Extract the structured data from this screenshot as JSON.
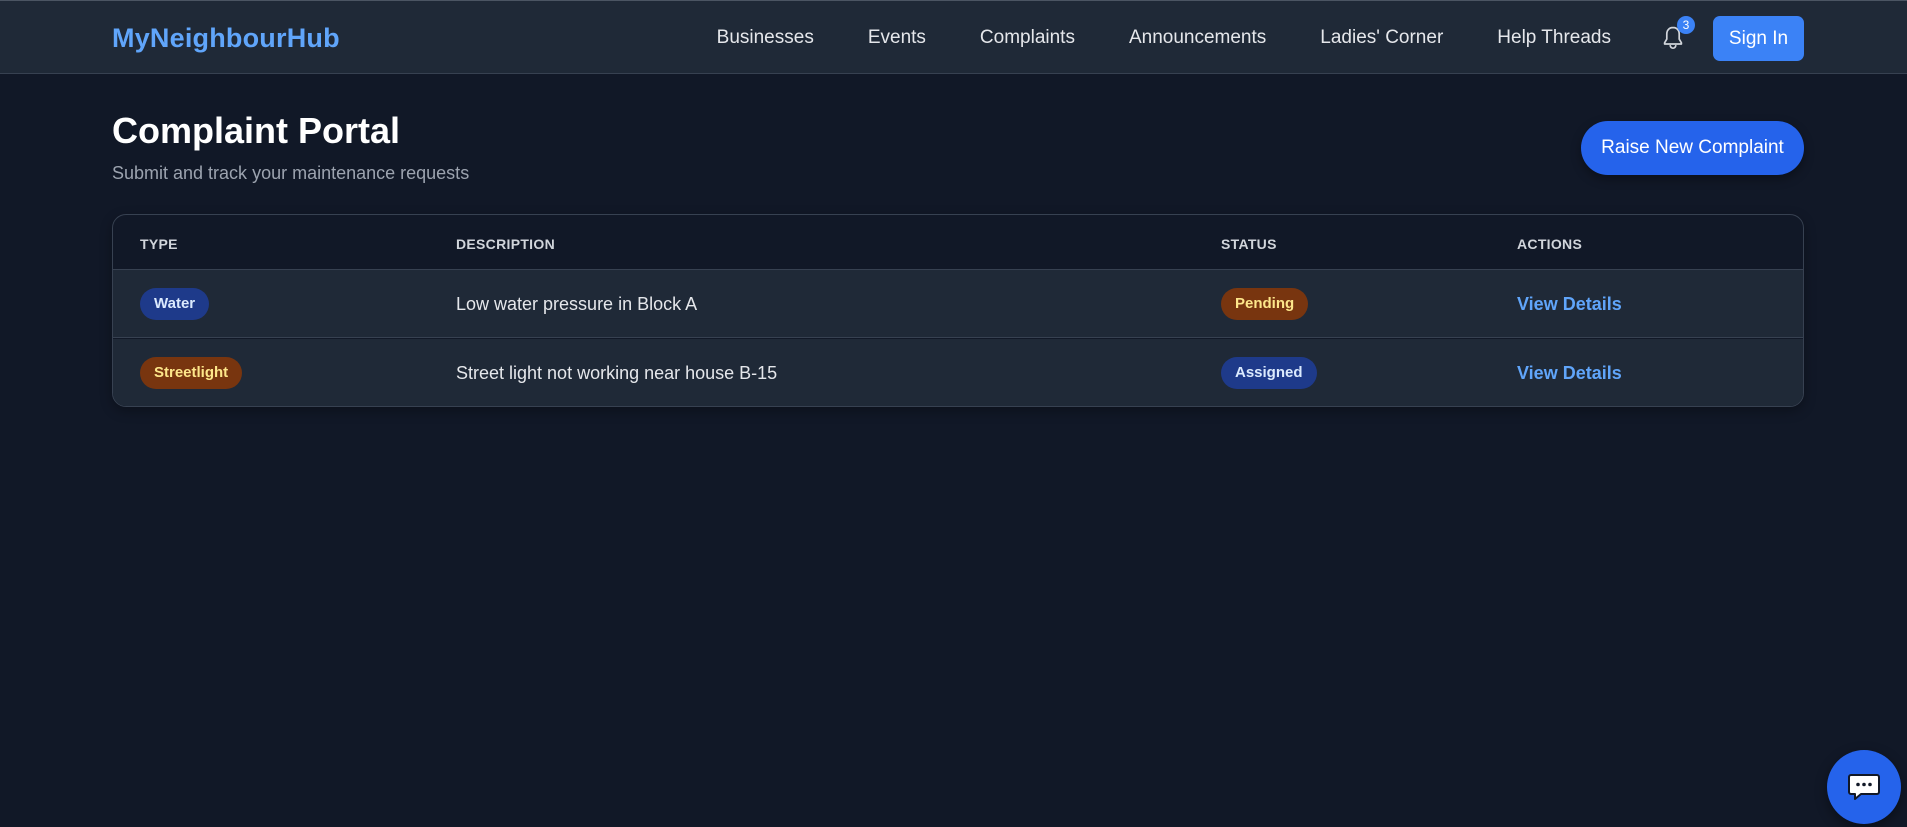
{
  "header": {
    "brand": "MyNeighbourHub",
    "nav": [
      "Businesses",
      "Events",
      "Complaints",
      "Announcements",
      "Ladies' Corner",
      "Help Threads"
    ],
    "notification_count": "3",
    "notification_icon": "bell-icon",
    "signin_label": "Sign In"
  },
  "page": {
    "title": "Complaint Portal",
    "subtitle": "Submit and track your maintenance requests",
    "raise_label": "Raise New Complaint"
  },
  "table": {
    "columns": [
      "TYPE",
      "DESCRIPTION",
      "STATUS",
      "ACTIONS"
    ],
    "rows": [
      {
        "type": "Water",
        "description": "Low water pressure in Block A",
        "status": "Pending",
        "action": "View Details"
      },
      {
        "type": "Streetlight",
        "description": "Street light not working near house B-15",
        "status": "Assigned",
        "action": "View Details"
      }
    ]
  },
  "chat": {
    "icon": "chat-bubble-icon"
  },
  "colors": {
    "background": "#111827",
    "navbar": "#1f2937",
    "accent": "#3b82f6",
    "brand": "#60a5fa",
    "pending": "#78350f",
    "assigned": "#1e3a8a"
  }
}
